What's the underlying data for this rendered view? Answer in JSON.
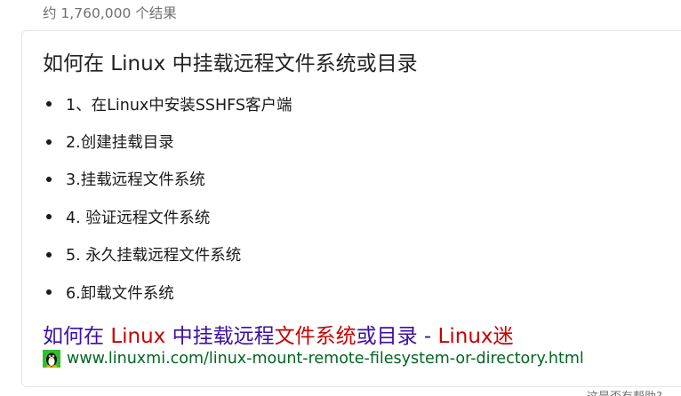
{
  "results": {
    "count_text": "约 1,760,000 个结果"
  },
  "featured_snippet": {
    "title": "如何在 Linux 中挂载远程文件系统或目录",
    "steps": [
      "1、在Linux中安装SSHFS客户端",
      "2.创建挂载目录",
      "3.挂载远程文件系统",
      "4. 验证远程文件系统",
      "5. 永久挂载远程文件系统",
      "6.卸载文件系统"
    ],
    "source": {
      "title_parts": [
        "如何在 ",
        "Linux",
        " 中挂载远程",
        "文件系统",
        "或目录 - ",
        "Linux",
        "迷"
      ],
      "url": "www.linuxmi.com/linux-mount-remote-filesystem-or-directory.html",
      "favicon": "tux-penguin-icon"
    },
    "feedback_text": "这是否有帮助?"
  },
  "colors": {
    "link": "#3b0fa8",
    "highlight": "#c80000",
    "url": "#006621",
    "muted": "#707070"
  }
}
